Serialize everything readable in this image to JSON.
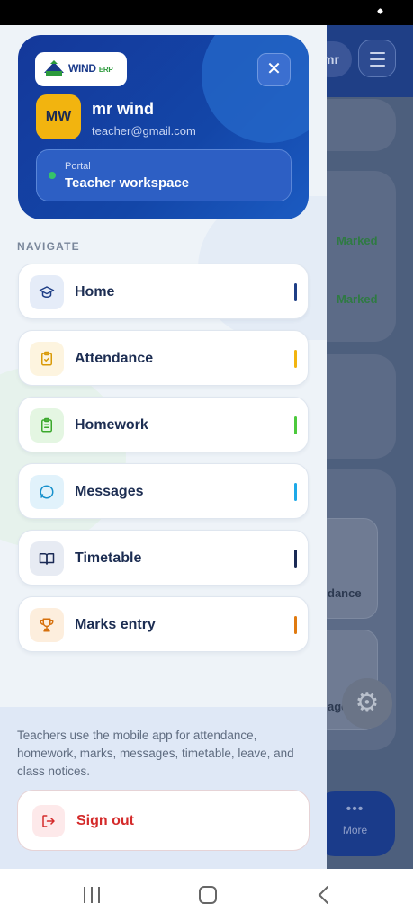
{
  "profile": {
    "logo_text": "WIND",
    "logo_suffix": "ERP",
    "initials": "MW",
    "name": "mr wind",
    "email": "teacher@gmail.com",
    "portal_label": "Portal",
    "portal_value": "Teacher workspace"
  },
  "navigate": {
    "heading": "NAVIGATE",
    "items": [
      {
        "label": "Home",
        "icon": "graduation-cap-icon",
        "accent": "#1f3f86"
      },
      {
        "label": "Attendance",
        "icon": "clipboard-check-icon",
        "accent": "#f2b40f"
      },
      {
        "label": "Homework",
        "icon": "clipboard-list-icon",
        "accent": "#4cc93c"
      },
      {
        "label": "Messages",
        "icon": "message-circle-icon",
        "accent": "#1ea9e8"
      },
      {
        "label": "Timetable",
        "icon": "book-open-icon",
        "accent": "#1a2a55"
      },
      {
        "label": "Marks entry",
        "icon": "trophy-icon",
        "accent": "#e07a10"
      }
    ]
  },
  "footer": {
    "note": "Teachers use the mobile app for attendance, homework, marks, messages, timetable, leave, and class notices.",
    "signout_label": "Sign out"
  },
  "background": {
    "avatar_text": "mr",
    "marked_1": "Marked",
    "marked_2": "Marked",
    "tile_1": "dance",
    "tile_2": "ages",
    "more_label": "More"
  }
}
